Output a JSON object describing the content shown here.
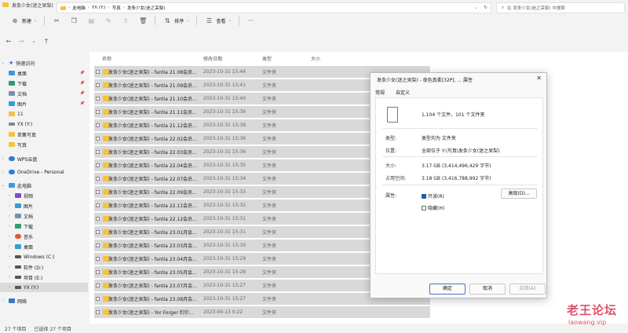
{
  "window": {
    "title": "发条少女(迷之呆梨)"
  },
  "toolbar": {
    "new_label": "新建",
    "sort_label": "排序",
    "view_label": "查看"
  },
  "address": {
    "crumbs": [
      "此电脑",
      "YX (Y:)",
      "写真",
      "发条少女(迷之呆梨)"
    ],
    "search_placeholder": "在 发条少女(迷之呆梨) 中搜索"
  },
  "sidebar": {
    "items": [
      {
        "label": "快速访问",
        "icon": "star-icon"
      },
      {
        "label": "桌面",
        "icon": "desktop-icon"
      },
      {
        "label": "下载",
        "icon": "download-icon"
      },
      {
        "label": "文档",
        "icon": "document-icon"
      },
      {
        "label": "图片",
        "icon": "picture-icon"
      },
      {
        "label": "11",
        "icon": "folder-icon"
      },
      {
        "label": "YX (Y:)",
        "icon": "drive-icon"
      },
      {
        "label": "单集写真",
        "icon": "folder-icon"
      },
      {
        "label": "写真",
        "icon": "folder-icon"
      },
      {
        "label": "WPS云盘",
        "icon": "cloud-icon"
      },
      {
        "label": "OneDrive - Personal",
        "icon": "onedrive-icon"
      },
      {
        "label": "此电脑",
        "icon": "computer-icon"
      },
      {
        "label": "视频",
        "icon": "video-icon"
      },
      {
        "label": "图片",
        "icon": "picture-icon"
      },
      {
        "label": "文档",
        "icon": "document-icon"
      },
      {
        "label": "下载",
        "icon": "download-icon"
      },
      {
        "label": "音乐",
        "icon": "music-icon"
      },
      {
        "label": "桌面",
        "icon": "desktop-icon"
      },
      {
        "label": "Windows (C:)",
        "icon": "drive-icon"
      },
      {
        "label": "软件 (D:)",
        "icon": "drive-icon"
      },
      {
        "label": "项目 (E:)",
        "icon": "drive-icon"
      },
      {
        "label": "YX (Y:)",
        "icon": "drive-icon"
      },
      {
        "label": "网络",
        "icon": "network-icon"
      }
    ]
  },
  "columns": {
    "name": "名称",
    "date": "修改日期",
    "type": "类型",
    "size": "大小"
  },
  "rows": [
    {
      "name": "发条少女(迷之呆梨) - fantia 21.08会员...",
      "date": "2023-10-31 15:44",
      "type": "文件夹"
    },
    {
      "name": "发条少女(迷之呆梨) - fantia 21.09会员...",
      "date": "2023-10-31 15:41",
      "type": "文件夹"
    },
    {
      "name": "发条少女(迷之呆梨) - fantia 21.10会员...",
      "date": "2023-10-31 15:40",
      "type": "文件夹"
    },
    {
      "name": "发条少女(迷之呆梨) - fantia 21.11会员...",
      "date": "2023-10-31 15:39",
      "type": "文件夹"
    },
    {
      "name": "发条少女(迷之呆梨) - fantia 21.12会员...",
      "date": "2023-10-31 15:38",
      "type": "文件夹"
    },
    {
      "name": "发条少女(迷之呆梨) - fantia 22.02会员...",
      "date": "2023-10-31 15:36",
      "type": "文件夹"
    },
    {
      "name": "发条少女(迷之呆梨) - fantia 22.03会员...",
      "date": "2023-10-31 15:36",
      "type": "文件夹"
    },
    {
      "name": "发条少女(迷之呆梨) - fantia 22.04会员...",
      "date": "2023-10-31 15:35",
      "type": "文件夹"
    },
    {
      "name": "发条少女(迷之呆梨) - fantia 22.07会员...",
      "date": "2023-10-31 15:34",
      "type": "文件夹"
    },
    {
      "name": "发条少女(迷之呆梨) - fantia 22.09会员...",
      "date": "2023-10-31 15:33",
      "type": "文件夹"
    },
    {
      "name": "发条少女(迷之呆梨) - fantia 22.11会员...",
      "date": "2023-10-31 15:32",
      "type": "文件夹"
    },
    {
      "name": "发条少女(迷之呆梨) - fantia 22.12会员...",
      "date": "2023-10-31 15:31",
      "type": "文件夹"
    },
    {
      "name": "发条少女(迷之呆梨) - fantia 23.01月会...",
      "date": "2023-10-31 15:31",
      "type": "文件夹"
    },
    {
      "name": "发条少女(迷之呆梨) - fantia 23.03月会...",
      "date": "2023-10-31 15:30",
      "type": "文件夹"
    },
    {
      "name": "发条少女(迷之呆梨) - fantia 23.04月会...",
      "date": "2023-10-31 15:29",
      "type": "文件夹"
    },
    {
      "name": "发条少女(迷之呆梨) - fantia 23.05月会...",
      "date": "2023-10-31 15:28",
      "type": "文件夹"
    },
    {
      "name": "发条少女(迷之呆梨) - fantia 23.07月会...",
      "date": "2023-10-31 15:27",
      "type": "文件夹"
    },
    {
      "name": "发条少女(迷之呆梨) - fantia 23.08月会...",
      "date": "2023-10-31 15:27",
      "type": "文件夹"
    },
    {
      "name": "发条少女(迷之呆梨) - Yor Forger 约尔...",
      "date": "2023-09-13 0:22",
      "type": "文件夹"
    }
  ],
  "status": {
    "count": "27 个项目",
    "selected": "已选择 27 个项目"
  },
  "dialog": {
    "title": "发条少女(迷之呆梨) - 夜色真柔[32P], ... 属性",
    "tab_general": "常规",
    "tab_custom": "自定义",
    "file_count": "1,104 个文件，101 个文件夹",
    "type_label": "类型:",
    "type_value": "类型均为 文件夹",
    "location_label": "位置:",
    "location_value": "全部位于 Y:\\写真\\发条少女(迷之呆梨)",
    "size_label": "大小:",
    "size_value": "3.17 GB (3,414,496,429 字节)",
    "disk_label": "占用空间:",
    "disk_value": "3.18 GB (3,416,788,992 字节)",
    "attr_label": "属性:",
    "readonly_label": "只读(R)",
    "hidden_label": "隐藏(H)",
    "advanced_label": "高级(D)...",
    "ok_label": "确定",
    "cancel_label": "取消",
    "apply_label": "应用(A)"
  },
  "watermark": {
    "big": "老王论坛",
    "small": "laowang.vip"
  },
  "colors": {
    "folder": "#f5c342",
    "selection": "#d9d9d9",
    "accent": "#1e5fa8",
    "watermark": "#e0506a"
  }
}
